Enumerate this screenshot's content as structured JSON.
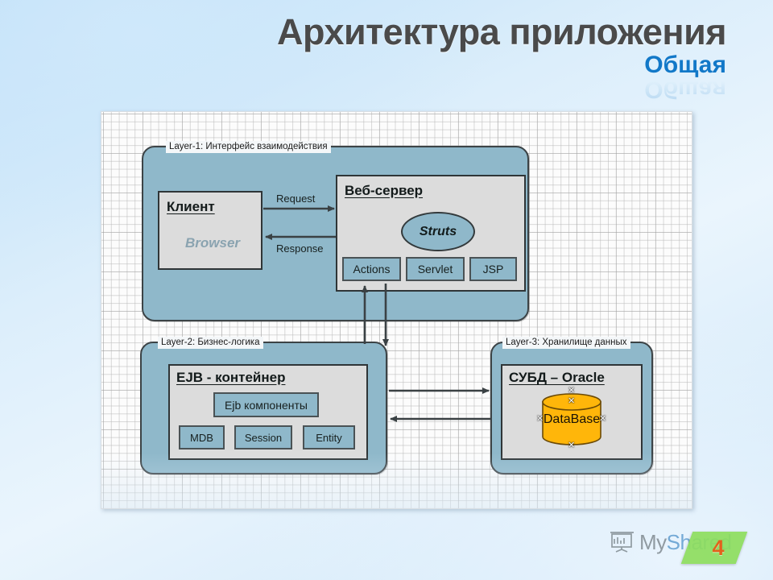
{
  "slide": {
    "title": "Архитектура приложения",
    "subtitle": "Общая",
    "number": "4"
  },
  "watermark": {
    "text_part1": "My",
    "text_part2": "Shared",
    "logo_icon": "presentation-board-icon"
  },
  "diagram": {
    "layer1": {
      "tag": "Layer-1: Интерфейс взаимодействия",
      "client": {
        "header": "Клиент",
        "sub": "Browser"
      },
      "webserver": {
        "header": "Веб-сервер",
        "ellipse": "Struts",
        "chips": [
          "Actions",
          "Servlet",
          "JSP"
        ]
      },
      "arrows": {
        "request": "Request",
        "response": "Response"
      }
    },
    "layer2": {
      "tag": "Layer-2: Бизнес-логика",
      "container": {
        "header": "EJB - контейнер",
        "component": "Ejb компоненты",
        "chips": [
          "MDB",
          "Session",
          "Entity"
        ]
      }
    },
    "layer3": {
      "tag": "Layer-3: Хранилище данных",
      "dbms": {
        "header": "СУБД – Oracle",
        "database": "DataBase"
      }
    }
  },
  "colors": {
    "layer_fill": "#8fb8ca",
    "inner_fill": "#dcdcdc",
    "db_fill": "#ffb60a",
    "subtitle": "#1278c8",
    "title": "#4a4a4a",
    "badge": "#8ede5e",
    "slide_num": "#e2621c"
  }
}
